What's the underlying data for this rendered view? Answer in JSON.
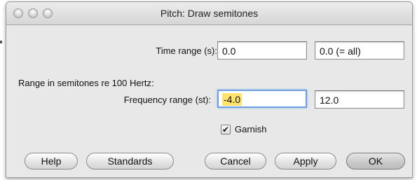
{
  "window": {
    "title": "Pitch: Draw semitones"
  },
  "form": {
    "time_range_label": "Time range (s):",
    "time_from": "0.0",
    "time_to": "0.0 (= all)",
    "section_label": "Range in semitones re 100 Hertz:",
    "freq_range_label": "Frequency range (st):",
    "freq_from": "-4.0",
    "freq_to": "12.0",
    "garnish_label": "Garnish",
    "garnish_checked": true
  },
  "buttons": {
    "help": "Help",
    "standards": "Standards",
    "cancel": "Cancel",
    "apply": "Apply",
    "ok": "OK"
  }
}
